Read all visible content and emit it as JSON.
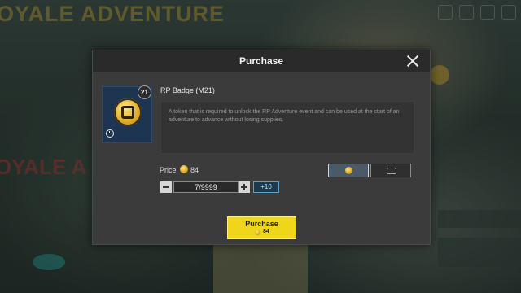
{
  "background": {
    "title": "OYALE ADVENTURE",
    "side_text": "OYALE A"
  },
  "dialog": {
    "title": "Purchase",
    "item": {
      "name": "RP Badge (M21)",
      "level": "21",
      "description": "A token that is required to unlock the RP Adventure event and can be used at the start of an adventure to advance without losing supplies."
    },
    "price": {
      "label": "Price",
      "value": "84"
    },
    "quantity": {
      "value": "7/9999",
      "plus10_label": "+10"
    },
    "currency_tabs": [
      {
        "icon": "coin-icon",
        "active": true
      },
      {
        "icon": "uc-icon",
        "active": false
      }
    ],
    "purchase_button": {
      "label": "Purchase",
      "amount": "84"
    }
  },
  "colors": {
    "dialog_bg": "#3b3b3b",
    "header_bg": "#2a2a2a",
    "purchase_button": "#f0d61a",
    "item_card_bg": "#1d3550",
    "plus10_border": "#5aa0c8"
  }
}
